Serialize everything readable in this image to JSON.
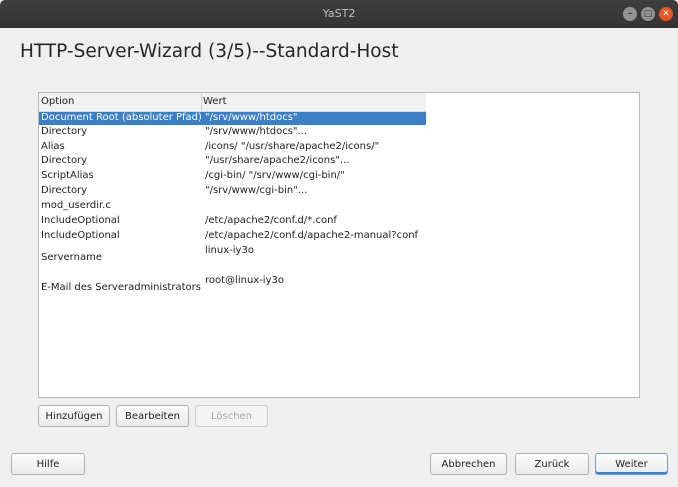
{
  "window": {
    "title": "YaST2"
  },
  "page": {
    "heading": "HTTP-Server-Wizard (3/5)--Standard-Host"
  },
  "table": {
    "columns": [
      "Option",
      "Wert"
    ],
    "rows": [
      {
        "option": "Document Root (absoluter Pfad)",
        "value": "\"/srv/www/htdocs\"",
        "selected": true
      },
      {
        "option": "Directory",
        "value": "\"/srv/www/htdocs\"..."
      },
      {
        "option": "Alias",
        "value": "/icons/ \"/usr/share/apache2/icons/\""
      },
      {
        "option": "Directory",
        "value": "\"/usr/share/apache2/icons\"..."
      },
      {
        "option": "ScriptAlias",
        "value": "/cgi-bin/ \"/srv/www/cgi-bin/\""
      },
      {
        "option": "Directory",
        "value": "\"/srv/www/cgi-bin\"..."
      },
      {
        "option": "mod_userdir.c",
        "value": ""
      },
      {
        "option": "IncludeOptional",
        "value": "/etc/apache2/conf.d/*.conf"
      },
      {
        "option": "IncludeOptional",
        "value": "/etc/apache2/conf.d/apache2-manual?conf"
      },
      {
        "option": "Servername",
        "value": "linux-iy3o"
      },
      {
        "option": "E-Mail des Serveradministrators",
        "value": "root@linux-iy3o"
      }
    ]
  },
  "table_buttons": {
    "add": "Hinzufügen",
    "edit": "Bearbeiten",
    "delete": "Löschen"
  },
  "footer": {
    "help": "Hilfe",
    "abort": "Abbrechen",
    "back": "Zurück",
    "next": "Weiter"
  }
}
